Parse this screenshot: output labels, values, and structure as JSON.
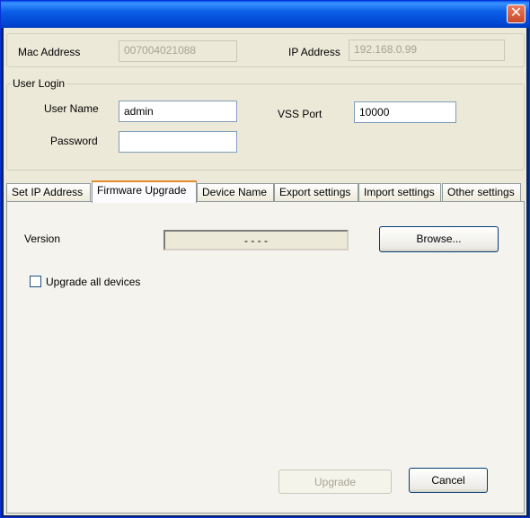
{
  "window": {
    "close_glyph": "✕"
  },
  "device_info": {
    "mac_label": "Mac Address",
    "mac_value": "007004021088",
    "ip_label": "IP Address",
    "ip_value": "192.168.0.99"
  },
  "user_login": {
    "legend": "User Login",
    "username_label": "User Name",
    "username_value": "admin",
    "password_label": "Password",
    "password_value": "",
    "vss_port_label": "VSS Port",
    "vss_port_value": "10000"
  },
  "tabs": [
    {
      "label": "Set IP Address"
    },
    {
      "label": "Firmware Upgrade",
      "active": true
    },
    {
      "label": "Device Name"
    },
    {
      "label": "Export settings"
    },
    {
      "label": "Import settings"
    },
    {
      "label": "Other settings"
    }
  ],
  "firmware": {
    "version_label": "Version",
    "version_value": "- - - -",
    "browse_label": "Browse...",
    "upgrade_all_label": "Upgrade all devices",
    "upgrade_all_checked": false
  },
  "footer": {
    "upgrade_label": "Upgrade",
    "cancel_label": "Cancel"
  },
  "colors": {
    "titlebar": "#0a5fe5",
    "dialog_bg": "#ece9d8",
    "tab_active_accent": "#e68b2c",
    "close_button": "#c94a2a"
  }
}
